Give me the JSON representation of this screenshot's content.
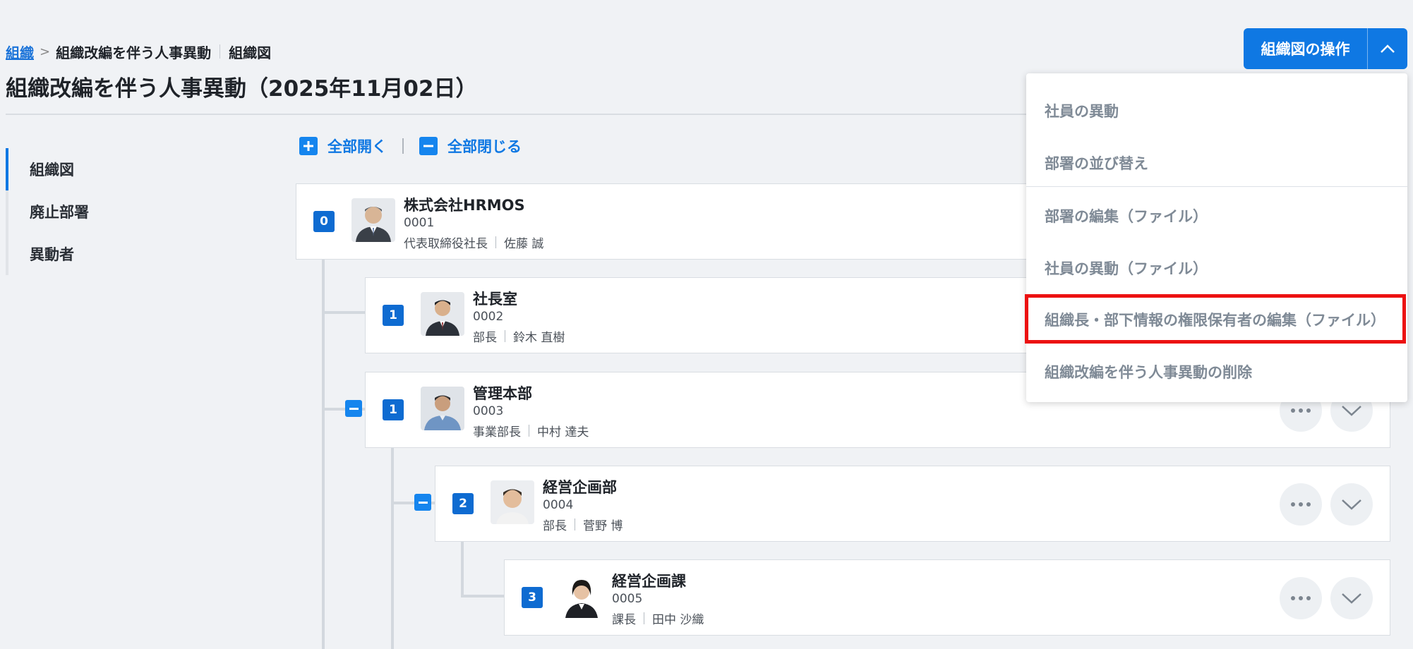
{
  "breadcrumb": {
    "root_link": "組織",
    "current": "組織改編を伴う人事異動",
    "sub": "組織図"
  },
  "page_title": "組織改編を伴う人事異動（2025年11月02日）",
  "ops_button": {
    "label": "組織図の操作",
    "caret_icon": "chevron-up-icon"
  },
  "sidenav": {
    "items": [
      {
        "label": "組織図",
        "active": true
      },
      {
        "label": "廃止部署",
        "active": false
      },
      {
        "label": "異動者",
        "active": false
      }
    ]
  },
  "tree_controls": {
    "expand_all": "全部開く",
    "collapse_all": "全部閉じる"
  },
  "departments": [
    {
      "level": "0",
      "name": "株式会社HRMOS",
      "code": "0001",
      "title": "代表取締役社長",
      "person": "佐藤 誠"
    },
    {
      "level": "1",
      "name": "社長室",
      "code": "0002",
      "title": "部長",
      "person": "鈴木 直樹"
    },
    {
      "level": "1",
      "name": "管理本部",
      "code": "0003",
      "title": "事業部長",
      "person": "中村 達夫"
    },
    {
      "level": "2",
      "name": "経営企画部",
      "code": "0004",
      "title": "部長",
      "person": "菅野 博"
    },
    {
      "level": "3",
      "name": "経営企画課",
      "code": "0005",
      "title": "課長",
      "person": "田中 沙織"
    }
  ],
  "dropdown": {
    "items": [
      "社員の異動",
      "部署の並び替え",
      "部署の編集（ファイル）",
      "社員の異動（ファイル）",
      "組織長・部下情報の権限保有者の編集（ファイル）",
      "組織改編を伴う人事異動の削除"
    ],
    "highlighted_index": 4,
    "highlight_color": "#ec1111"
  },
  "colors": {
    "primary": "#0f78e3",
    "level_badge": "#0e6bd1",
    "page_bg": "#f0f2f5"
  }
}
